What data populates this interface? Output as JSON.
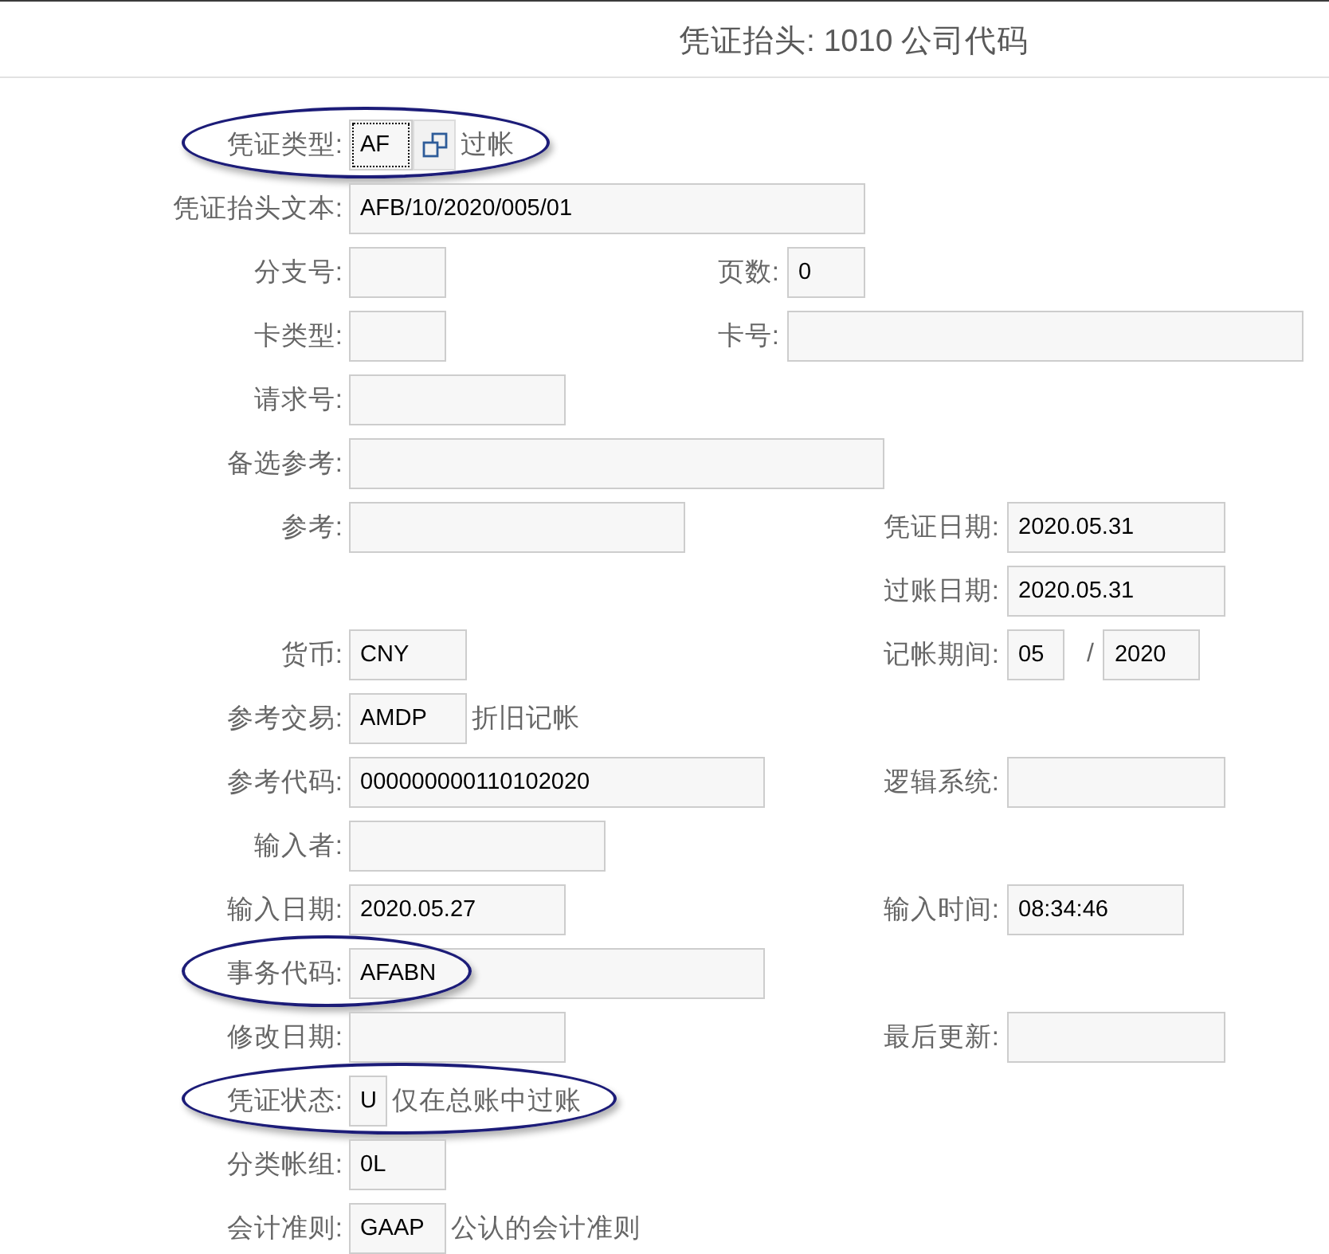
{
  "header": {
    "title": "凭证抬头: 1010 公司代码"
  },
  "sections": [
    {
      "rows": [
        {
          "circled": true,
          "left": {
            "label": "凭证类型:",
            "controls": [
              {
                "kind": "input",
                "value": "AF",
                "focused": true
              },
              {
                "kind": "help"
              },
              {
                "kind": "text",
                "text": "过帐"
              }
            ]
          }
        },
        {
          "circled": false,
          "left": {
            "label": "凭证抬头文本:",
            "controls": [
              {
                "kind": "input",
                "value": "AFB/10/2020/005/01",
                "focused": false
              }
            ]
          }
        },
        {
          "circled": false,
          "left": {
            "label": "分支号:",
            "controls": [
              {
                "kind": "input",
                "focused": false
              }
            ]
          },
          "right": {
            "label": "页数:",
            "controls": [
              {
                "kind": "input",
                "value": "0",
                "focused": false
              }
            ]
          }
        },
        {
          "circled": false,
          "left": {
            "label": "卡类型:",
            "controls": [
              {
                "kind": "input",
                "focused": false
              }
            ]
          },
          "right": {
            "label": "卡号:",
            "controls": [
              {
                "kind": "input",
                "focused": false
              }
            ]
          }
        },
        {
          "circled": false,
          "left": {
            "label": "请求号:",
            "controls": [
              {
                "kind": "input",
                "focused": false
              }
            ]
          }
        },
        {
          "circled": false,
          "left": {
            "label": "备选参考:",
            "controls": [
              {
                "kind": "input",
                "focused": false
              }
            ]
          }
        }
      ]
    },
    {
      "rows": [
        {
          "circled": false,
          "left": {
            "label": "参考:",
            "controls": [
              {
                "kind": "input",
                "focused": false
              }
            ]
          },
          "right": {
            "label": "凭证日期:",
            "controls": [
              {
                "kind": "input",
                "value": "2020.05.31",
                "focused": false
              }
            ]
          }
        },
        {
          "circled": false,
          "right": {
            "label": "过账日期:",
            "controls": [
              {
                "kind": "input",
                "value": "2020.05.31",
                "focused": false
              }
            ]
          }
        },
        {
          "circled": false,
          "left": {
            "label": "货币:",
            "controls": [
              {
                "kind": "input",
                "value": "CNY",
                "focused": false
              }
            ]
          },
          "right": {
            "label": "记帐期间:",
            "controls": [
              {
                "kind": "input",
                "value": "05",
                "focused": false
              },
              {
                "kind": "separator",
                "text": "/"
              },
              {
                "kind": "input",
                "value": "2020",
                "focused": false
              }
            ]
          }
        },
        {
          "circled": false,
          "left": {
            "label": "参考交易:",
            "controls": [
              {
                "kind": "input",
                "value": "AMDP",
                "focused": false
              },
              {
                "kind": "text",
                "text": "折旧记帐"
              }
            ]
          }
        },
        {
          "circled": false,
          "left": {
            "label": "参考代码:",
            "controls": [
              {
                "kind": "input",
                "value": "000000000110102020",
                "focused": false
              }
            ]
          },
          "right": {
            "label": "逻辑系统:",
            "controls": [
              {
                "kind": "input",
                "focused": false
              }
            ]
          }
        },
        {
          "circled": false,
          "left": {
            "label": "输入者:",
            "controls": [
              {
                "kind": "input",
                "focused": false
              }
            ]
          }
        },
        {
          "circled": false,
          "left": {
            "label": "输入日期:",
            "controls": [
              {
                "kind": "input",
                "value": "2020.05.27",
                "focused": false
              }
            ]
          },
          "right": {
            "label": "输入时间:",
            "controls": [
              {
                "kind": "input",
                "value": "08:34:46",
                "focused": false
              }
            ]
          }
        },
        {
          "circled": true,
          "left": {
            "label": "事务代码:",
            "controls": [
              {
                "kind": "input",
                "value": "AFABN",
                "focused": false
              }
            ]
          }
        },
        {
          "circled": false,
          "left": {
            "label": "修改日期:",
            "controls": [
              {
                "kind": "input",
                "focused": false
              }
            ]
          },
          "right": {
            "label": "最后更新:",
            "controls": [
              {
                "kind": "input",
                "focused": false
              }
            ]
          }
        },
        {
          "circled": true,
          "left": {
            "label": "凭证状态:",
            "controls": [
              {
                "kind": "input",
                "value": "U",
                "focused": false
              },
              {
                "kind": "text",
                "text": "仅在总账中过账"
              }
            ]
          }
        },
        {
          "circled": false,
          "left": {
            "label": "分类帐组:",
            "controls": [
              {
                "kind": "input",
                "value": "0L",
                "focused": false
              }
            ]
          }
        },
        {
          "circled": false,
          "left": {
            "label": "会计准则:",
            "controls": [
              {
                "kind": "input",
                "value": "GAAP",
                "focused": false
              },
              {
                "kind": "text",
                "text": "公认的会计准则"
              }
            ]
          }
        }
      ]
    }
  ]
}
